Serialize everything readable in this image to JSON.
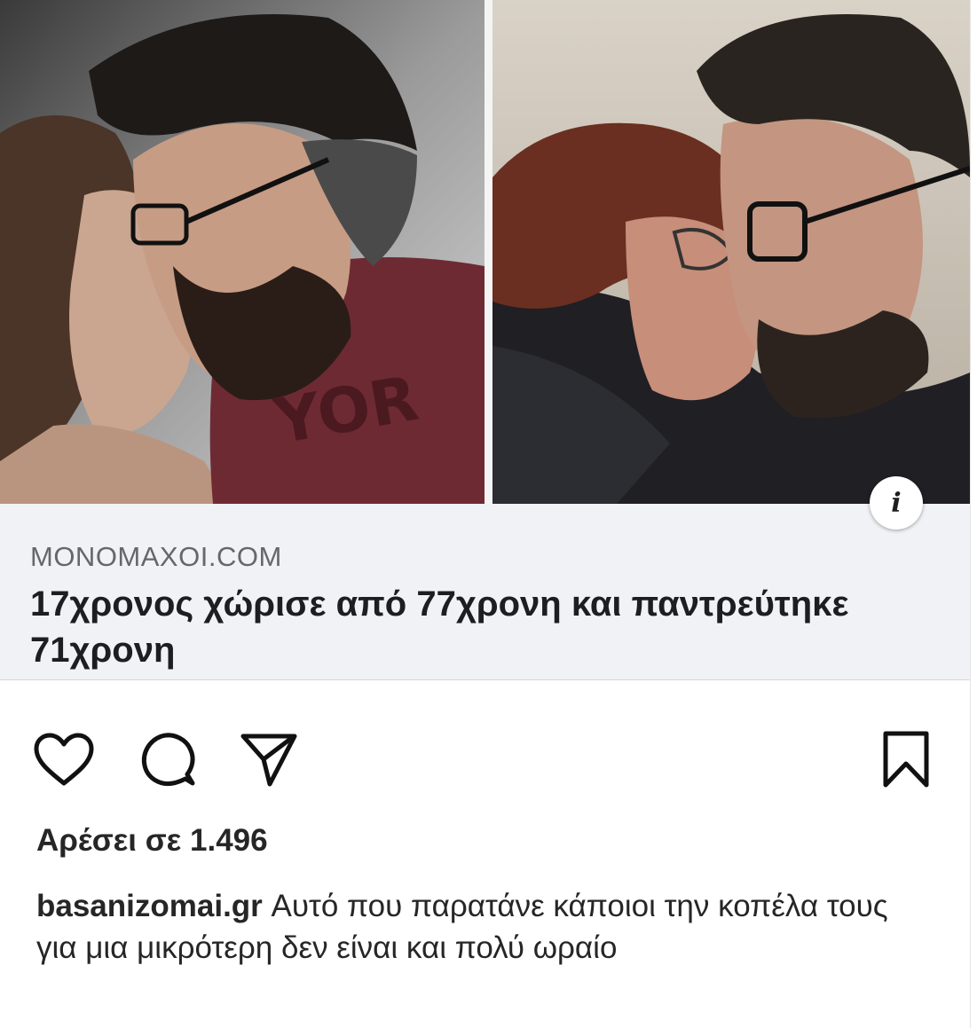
{
  "link_preview": {
    "domain": "MONOMAXOI.COM",
    "title": "17χρονος χώρισε από 77χρονη και παντρεύτηκε 71χρονη",
    "info_symbol": "i"
  },
  "actions": {
    "like_icon": "heart-icon",
    "comment_icon": "comment-icon",
    "share_icon": "paper-plane-icon",
    "save_icon": "bookmark-icon"
  },
  "likes_text": "Αρέσει σε 1.496",
  "caption": {
    "username": "basanizomai.gr",
    "text": "Αυτό που παρατάνε κάποιοι την κοπέλα τους για μια μικρότερη δεν είναι και πολύ ωραίο"
  },
  "colors": {
    "card_bg": "#f0f2f5",
    "text_primary": "#262626",
    "text_secondary": "#65676b"
  }
}
